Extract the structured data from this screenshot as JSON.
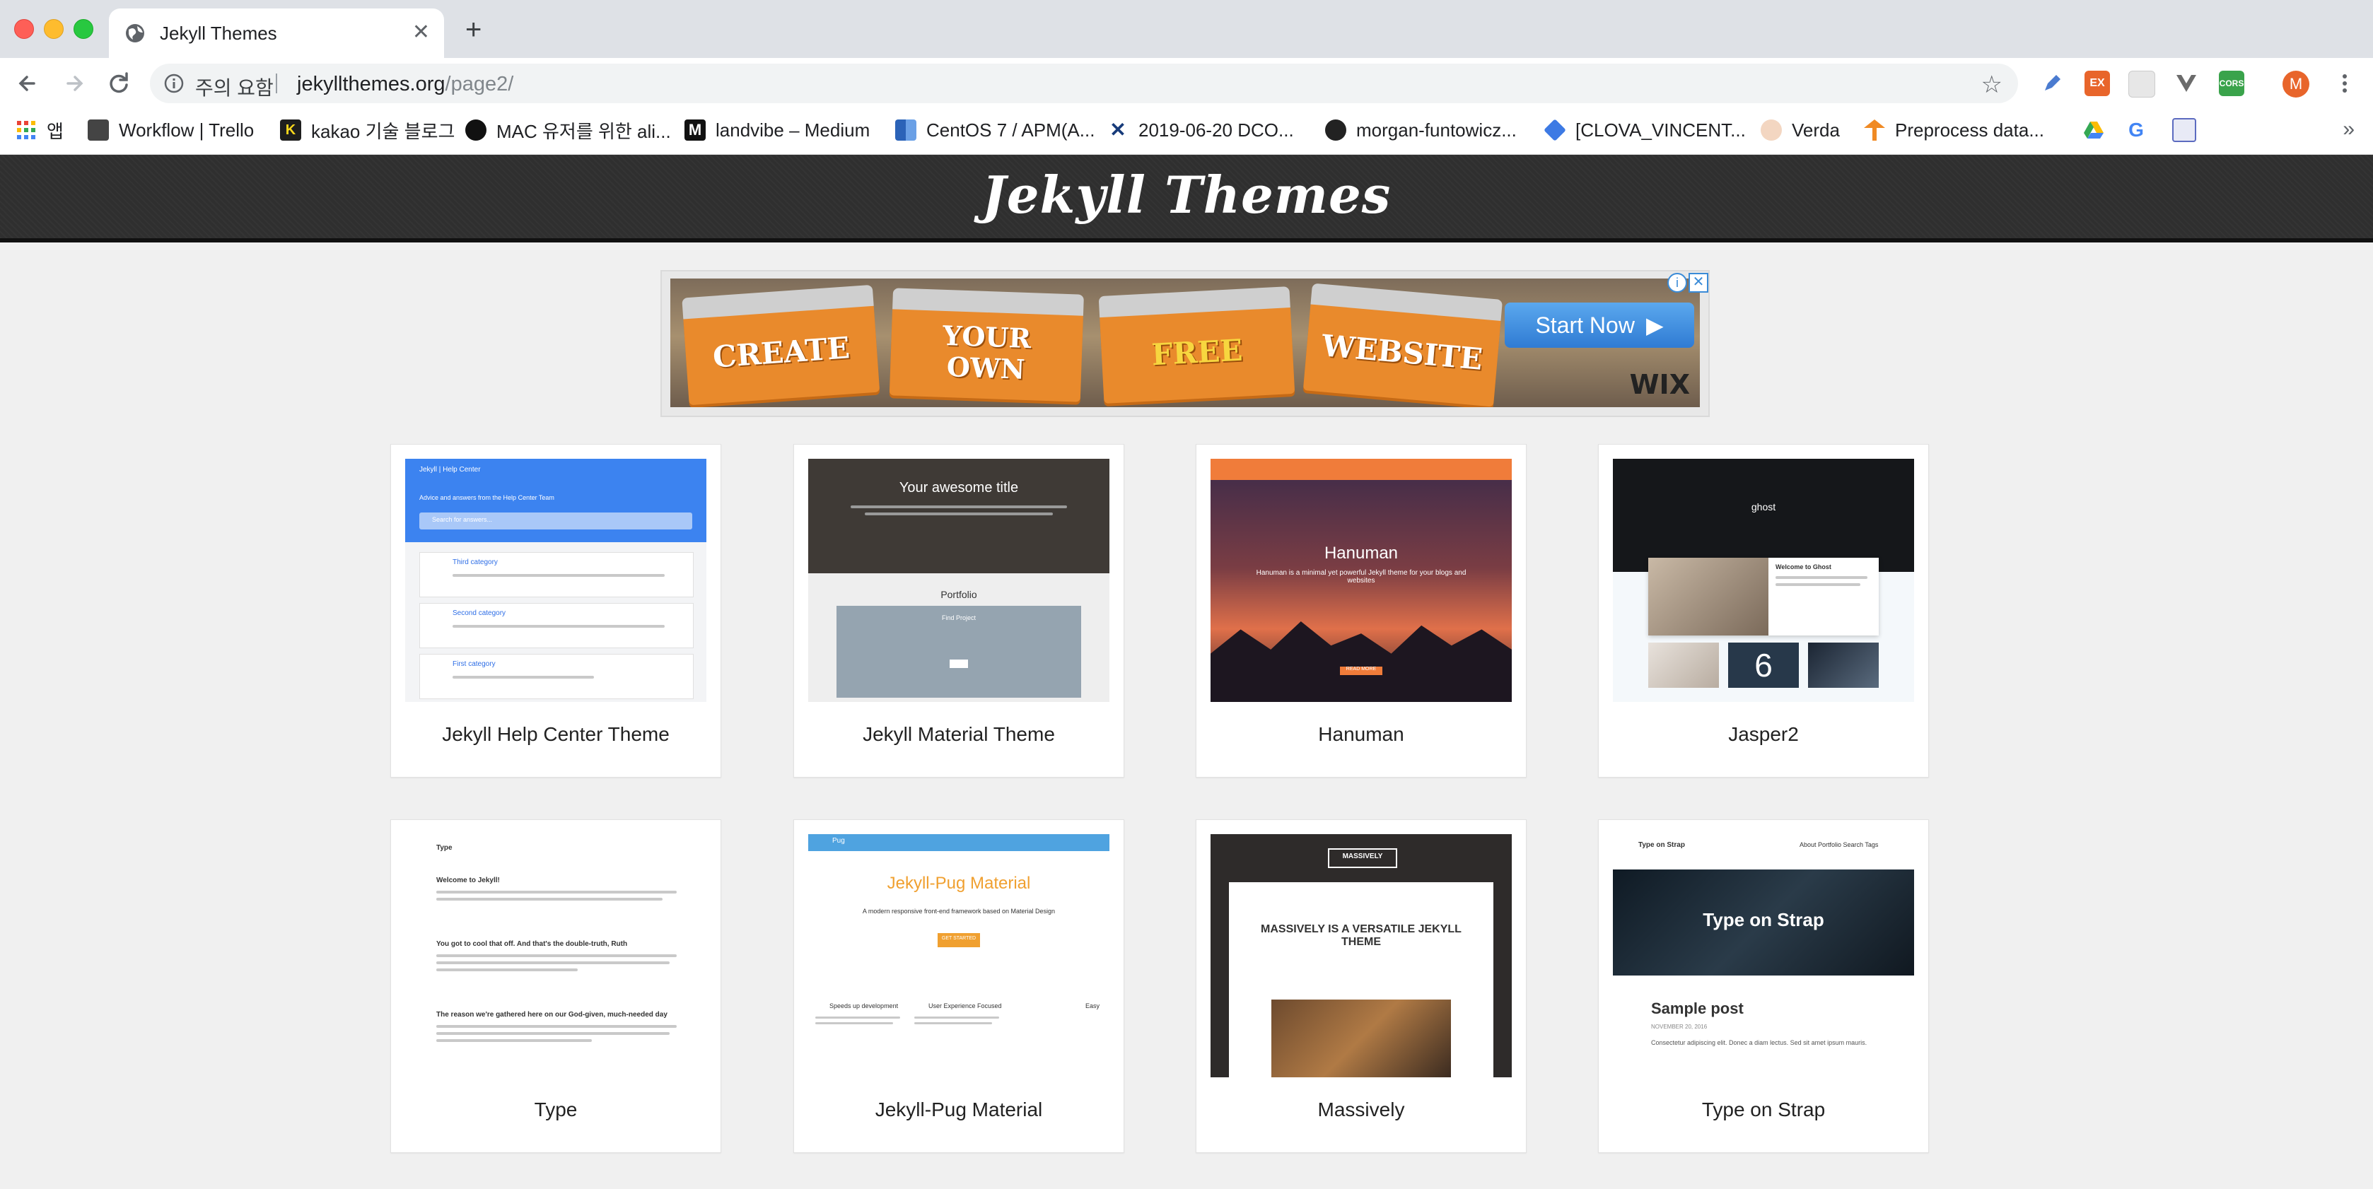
{
  "browser": {
    "tab_title": "Jekyll Themes",
    "tab_close": "✕",
    "new_tab": "+",
    "security_warning": "주의 요함",
    "url_host": "jekyllthemes.org",
    "url_path": "/page2/",
    "star": "☆",
    "profile_initial": "M",
    "bookmarks_more": "»",
    "bookmarks": [
      {
        "label": "앱",
        "color": "#e94235"
      },
      {
        "label": "Workflow | Trello",
        "color": "#444444"
      },
      {
        "label": "kakao 기술 블로그",
        "color": "#1e1e1e"
      },
      {
        "label": "MAC 유저를 위한 ali...",
        "color": "#111111"
      },
      {
        "label": "landvibe – Medium",
        "color": "#111111"
      },
      {
        "label": "CentOS 7 / APM(A...",
        "color": "#2b63b8"
      },
      {
        "label": "2019-06-20 DCO...",
        "color": "#173b7a"
      },
      {
        "label": "morgan-funtowicz...",
        "color": "#222222"
      },
      {
        "label": "[CLOVA_VINCENT...",
        "color": "#3d7ae4"
      },
      {
        "label": "Verda",
        "color": "#d28b5c"
      },
      {
        "label": "Preprocess data...",
        "color": "#f08a24"
      }
    ]
  },
  "site": {
    "title": "Jekyll Themes"
  },
  "ad": {
    "words": [
      "CREATE",
      "YOUR OWN",
      "FREE",
      "WEBSITE"
    ],
    "cta": "Start Now",
    "brand": "WIX",
    "info": "i",
    "close": "✕"
  },
  "themes": [
    {
      "name": "Jekyll Help Center Theme",
      "thumb_text": [
        "Jekyll | Help Center",
        "Advice and answers from the Help Center Team",
        "Search for answers...",
        "Third category",
        "Second category",
        "First category"
      ]
    },
    {
      "name": "Jekyll Material Theme",
      "thumb_text": [
        "Your awesome title",
        "Portfolio",
        "Find Project"
      ]
    },
    {
      "name": "Hanuman",
      "thumb_text": [
        "Hanuman",
        "Hanuman is a minimal yet powerful Jekyll theme for your blogs and websites",
        "READ MORE"
      ]
    },
    {
      "name": "Jasper2",
      "thumb_text": [
        "ghost",
        "Welcome to Ghost"
      ]
    },
    {
      "name": "Type",
      "thumb_text": [
        "Type",
        "Welcome to Jekyll!",
        "You got to cool that off. And that's the double-truth, Ruth",
        "The reason we're gathered here on our God-given, much-needed day"
      ]
    },
    {
      "name": "Jekyll-Pug Material",
      "thumb_text": [
        "Pug",
        "Jekyll-Pug Material",
        "A modern responsive front-end framework based on Material Design",
        "GET STARTED",
        "Speeds up development",
        "User Experience Focused",
        "Easy"
      ]
    },
    {
      "name": "Massively",
      "thumb_text": [
        "MASSIVELY",
        "MASSIVELY IS A VERSATILE JEKYLL THEME"
      ]
    },
    {
      "name": "Type on Strap",
      "thumb_text": [
        "Type on Strap",
        "About  Portfolio  Search  Tags",
        "Type on Strap",
        "Sample post",
        "NOVEMBER 20, 2016",
        "Consectetur adipiscing elit. Donec a diam lectus. Sed sit amet ipsum mauris."
      ]
    }
  ]
}
